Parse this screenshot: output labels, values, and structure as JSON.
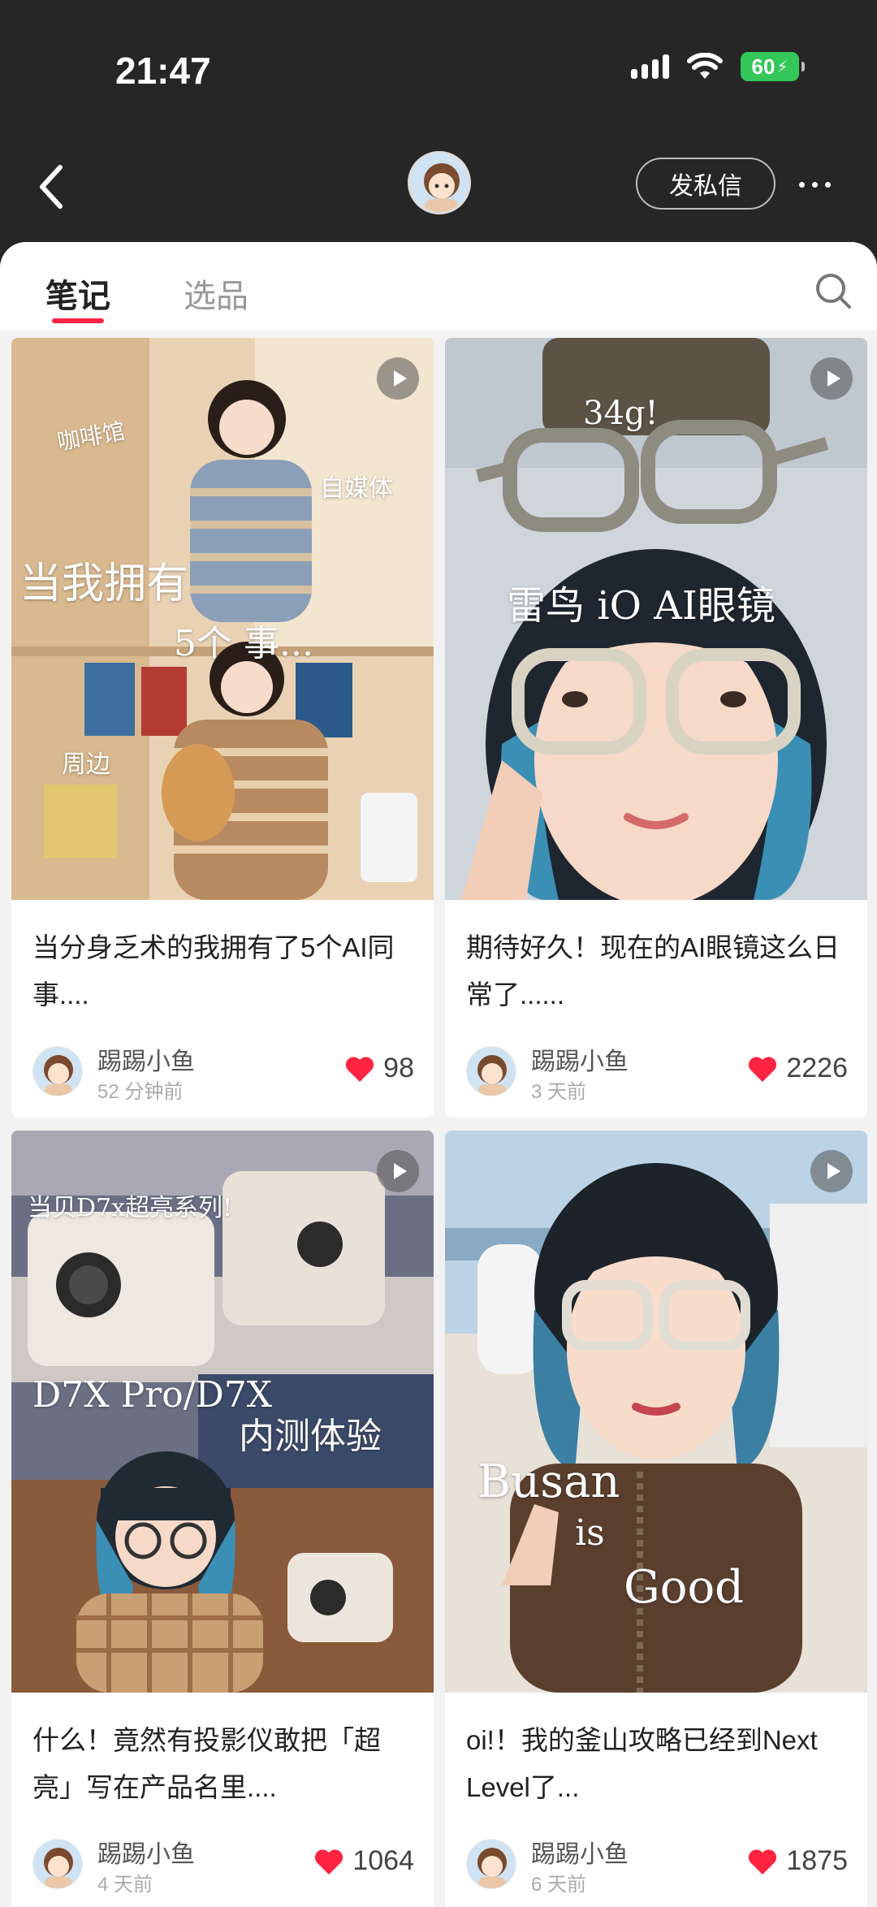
{
  "status": {
    "time": "21:47",
    "battery": "60"
  },
  "header": {
    "dm_label": "发私信"
  },
  "tabs": [
    {
      "label": "笔记",
      "active": true
    },
    {
      "label": "选品",
      "active": false
    }
  ],
  "colors": {
    "accent": "#ff2442",
    "header_bg": "#262626"
  },
  "notes": [
    {
      "title": "当分身乏术的我拥有了5个AI同事....",
      "author": "踢踢小鱼",
      "time": "52 分钟前",
      "likes": "98",
      "is_video": true,
      "overlay": {
        "a": "咖啡馆",
        "b": "自媒体",
        "c": "当我拥有",
        "d": "5个  事...",
        "e": "周边"
      }
    },
    {
      "title": "期待好久！现在的AI眼镜这么日常了......",
      "author": "踢踢小鱼",
      "time": "3 天前",
      "likes": "2226",
      "is_video": true,
      "overlay": {
        "a": "34g!",
        "b": "雷鸟 iO AI眼镜"
      }
    },
    {
      "title": "什么！竟然有投影仪敢把「超亮」写在产品名里....",
      "author": "踢踢小鱼",
      "time": "4 天前",
      "likes": "1064",
      "is_video": true,
      "overlay": {
        "a": "当贝D7x超亮系列!",
        "b": "D7X Pro/D7X",
        "c": "内测体验"
      }
    },
    {
      "title": "oi!！我的釜山攻略已经到Next Level了...",
      "author": "踢踢小鱼",
      "time": "6 天前",
      "likes": "1875",
      "is_video": true,
      "overlay": {
        "a": "Busan",
        "b": "is",
        "c": "Good"
      }
    }
  ]
}
